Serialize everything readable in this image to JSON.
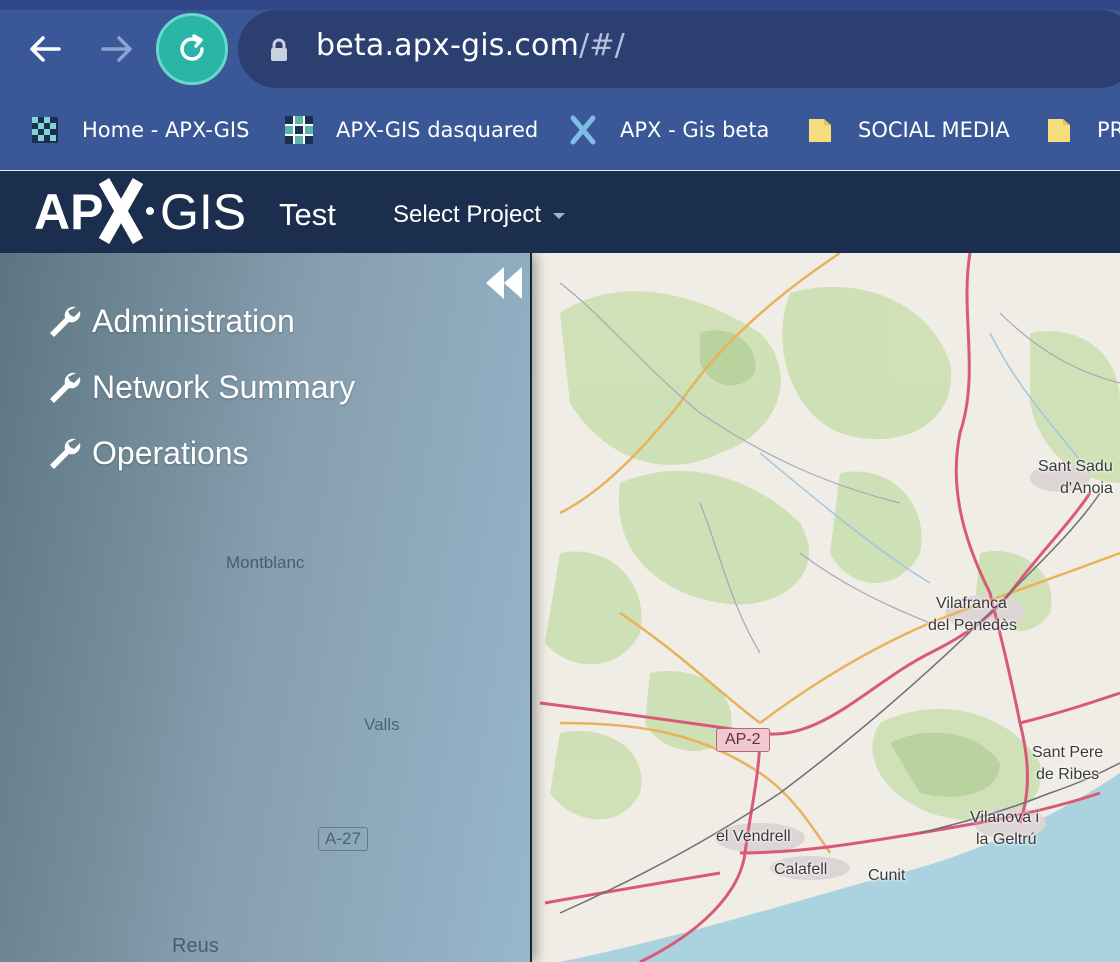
{
  "browser": {
    "url_host": "beta.apx-gis.com",
    "url_path": "/#/",
    "bookmarks": [
      {
        "label": "Home - APX-GIS",
        "icon": "checker-favicon-icon"
      },
      {
        "label": "APX-GIS dasquared",
        "icon": "grid-favicon-icon"
      },
      {
        "label": "APX - Gis beta",
        "icon": "x-favicon-icon"
      },
      {
        "label": "SOCIAL MEDIA",
        "icon": "folder-icon"
      },
      {
        "label": "PR",
        "icon": "folder-icon"
      }
    ]
  },
  "app": {
    "logo_text": "APX·GIS",
    "project_name": "Test",
    "select_project_label": "Select Project"
  },
  "sidebar": {
    "items": [
      {
        "label": "Administration",
        "icon": "wrench-icon"
      },
      {
        "label": "Network Summary",
        "icon": "wrench-icon"
      },
      {
        "label": "Operations",
        "icon": "wrench-icon"
      }
    ],
    "map_labels": [
      "Montblanc",
      "Valls",
      "A-27",
      "Reus"
    ]
  },
  "map": {
    "labels": {
      "sant_sadurni": [
        "Sant Sadu",
        "d'Anoia"
      ],
      "vilafranca": [
        "Vilafranca",
        "del Penedès"
      ],
      "sant_pere": [
        "Sant Pere",
        "de Ribes"
      ],
      "vilanova": [
        "Vilanova i",
        "la Geltrú"
      ],
      "vendrell": "el Vendrell",
      "calafell": "Calafell",
      "cunit": "Cunit",
      "ap2": "AP-2"
    }
  },
  "colors": {
    "browser_bar": "#3a5797",
    "app_bar": "#1b2e4d",
    "reload_accent": "#2ab4a6",
    "road_primary": "#d95a78",
    "road_secondary": "#e8b25a",
    "forest": "#cde0b4",
    "sea": "#aad3df"
  }
}
